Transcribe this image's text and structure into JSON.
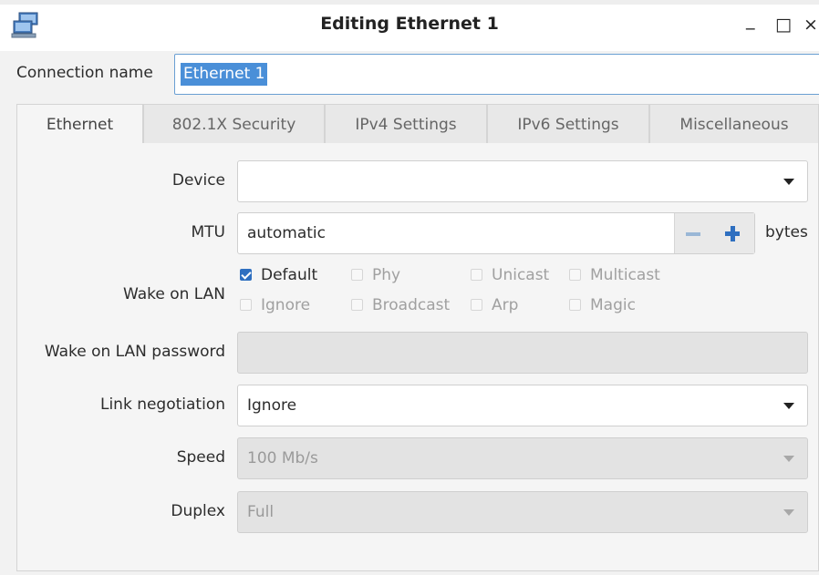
{
  "window": {
    "title": "Editing Ethernet 1",
    "icon": "network-computers-icon",
    "buttons": {
      "minimize": "_",
      "maximize": "□",
      "close": "×"
    }
  },
  "connection": {
    "label": "Connection name",
    "value": "Ethernet 1"
  },
  "tabs": [
    {
      "label": "Ethernet",
      "active": true
    },
    {
      "label": "802.1X Security",
      "active": false
    },
    {
      "label": "IPv4 Settings",
      "active": false
    },
    {
      "label": "IPv6 Settings",
      "active": false
    },
    {
      "label": "Miscellaneous",
      "active": false
    }
  ],
  "form": {
    "device": {
      "label": "Device",
      "value": ""
    },
    "mtu": {
      "label": "MTU",
      "value": "automatic",
      "unit": "bytes"
    },
    "wol": {
      "label": "Wake on LAN",
      "options": [
        {
          "label": "Default",
          "checked": true,
          "enabled": true
        },
        {
          "label": "Phy",
          "checked": false,
          "enabled": false
        },
        {
          "label": "Unicast",
          "checked": false,
          "enabled": false
        },
        {
          "label": "Multicast",
          "checked": false,
          "enabled": false
        },
        {
          "label": "Ignore",
          "checked": false,
          "enabled": false
        },
        {
          "label": "Broadcast",
          "checked": false,
          "enabled": false
        },
        {
          "label": "Arp",
          "checked": false,
          "enabled": false
        },
        {
          "label": "Magic",
          "checked": false,
          "enabled": false
        }
      ]
    },
    "wol_password": {
      "label": "Wake on LAN password",
      "value": ""
    },
    "link_negotiation": {
      "label": "Link negotiation",
      "value": "Ignore"
    },
    "speed": {
      "label": "Speed",
      "value": "100 Mb/s"
    },
    "duplex": {
      "label": "Duplex",
      "value": "Full"
    }
  },
  "colors": {
    "accent": "#2e6fc0",
    "selection": "#4a8fd8"
  }
}
